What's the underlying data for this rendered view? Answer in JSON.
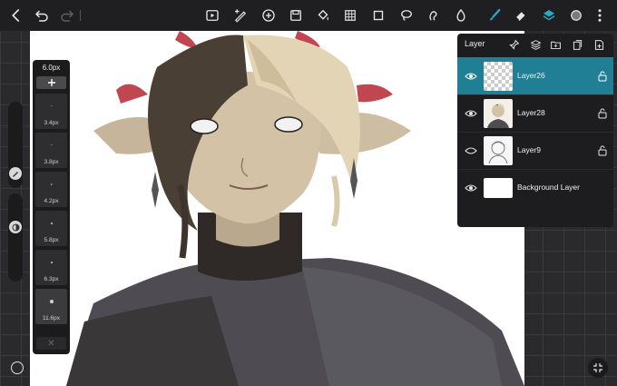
{
  "app": {
    "accent_color": "#207e95"
  },
  "toolbar": {
    "left": [
      {
        "name": "back-icon"
      },
      {
        "name": "undo-icon"
      },
      {
        "name": "redo-icon"
      }
    ],
    "tools": [
      {
        "name": "video-icon"
      },
      {
        "name": "adjust-brush-icon"
      },
      {
        "name": "add-icon"
      },
      {
        "name": "save-icon"
      },
      {
        "name": "fill-icon"
      },
      {
        "name": "grid-icon"
      },
      {
        "name": "crop-icon"
      },
      {
        "name": "lasso-icon"
      },
      {
        "name": "smudge-icon"
      },
      {
        "name": "drop-icon"
      },
      {
        "name": "brush-icon",
        "active": true
      },
      {
        "name": "eraser-icon"
      },
      {
        "name": "layers-icon"
      },
      {
        "name": "color-icon"
      },
      {
        "name": "more-icon"
      }
    ]
  },
  "brush_panel": {
    "current_size": "6.0px",
    "presets": [
      {
        "label": "3.4px"
      },
      {
        "label": "3.8px"
      },
      {
        "label": "4.2px"
      },
      {
        "label": "5.8px"
      },
      {
        "label": "6.3px"
      },
      {
        "label": "11.6px"
      }
    ]
  },
  "sliders": {
    "size_icon": "pencil-icon",
    "opacity_icon": "opacity-icon"
  },
  "layers_panel": {
    "title": "Layer",
    "header_icons": [
      "pin-icon",
      "stack-icon",
      "folder-icon",
      "copy-icon",
      "add-layer-icon"
    ],
    "layers": [
      {
        "name": "Layer26",
        "visible": true,
        "active": true,
        "thumb": "transparent"
      },
      {
        "name": "Layer28",
        "visible": true,
        "active": false,
        "thumb": "portrait"
      },
      {
        "name": "Layer9",
        "visible": false,
        "active": false,
        "thumb": "sketch"
      },
      {
        "name": "Background Layer",
        "visible": true,
        "active": false,
        "thumb": "white"
      }
    ]
  }
}
